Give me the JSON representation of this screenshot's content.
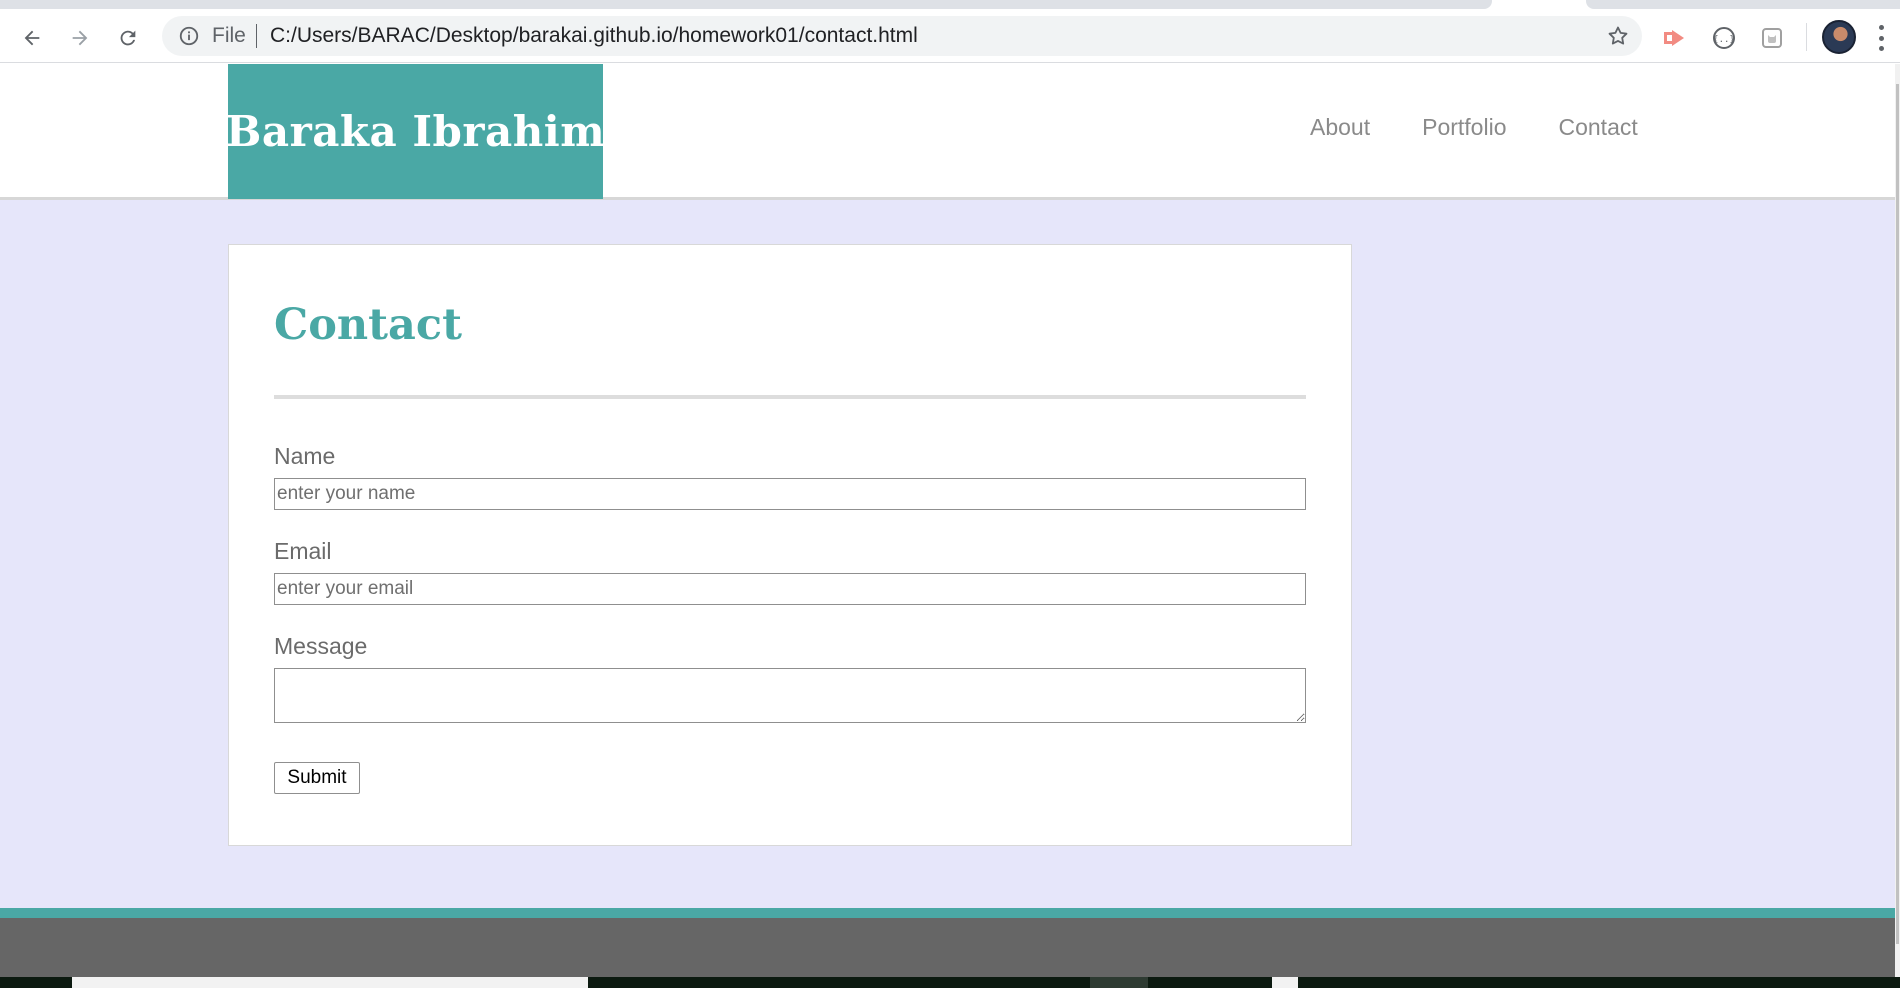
{
  "browser": {
    "address_scheme_label": "File",
    "address_url": "C:/Users/BARAC/Desktop/barakai.github.io/homework01/contact.html",
    "colors": {
      "chrome_bg": "#ffffff",
      "omnibox_bg": "#f1f3f4",
      "extension_accent": "#f28b82"
    },
    "toolbar_icons": [
      "back-arrow-icon",
      "forward-arrow-icon",
      "reload-icon",
      "info-icon",
      "star-icon",
      "cast-extension-icon",
      "json-extension-icon",
      "cat-extension-icon",
      "profile-avatar",
      "menu-dots-icon"
    ]
  },
  "site": {
    "brand": "Baraka Ibrahim",
    "nav": [
      {
        "label": "About"
      },
      {
        "label": "Portfolio"
      },
      {
        "label": "Contact"
      }
    ],
    "colors": {
      "accent": "#4aa8a5",
      "page_bg": "#e6e6fa",
      "footer": "#666666",
      "nav_text": "#8a8a8a"
    }
  },
  "contact": {
    "title": "Contact",
    "fields": {
      "name": {
        "label": "Name",
        "placeholder": "enter your name"
      },
      "email": {
        "label": "Email",
        "placeholder": "enter your email"
      },
      "message": {
        "label": "Message"
      }
    },
    "submit_label": "Submit"
  }
}
